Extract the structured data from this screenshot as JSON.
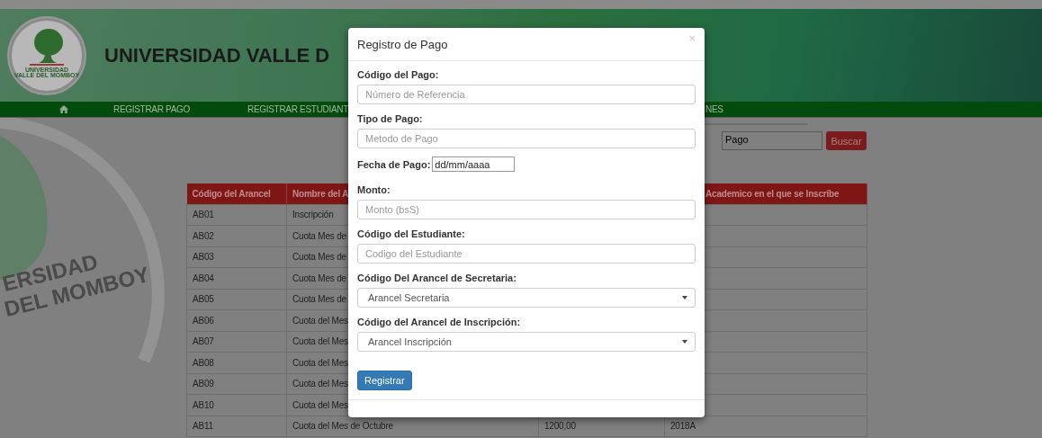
{
  "header": {
    "logo_lines": [
      "UNIVERSIDAD",
      "VALLE DEL MOMBOY"
    ],
    "title": "UNIVERSIDAD VALLE D"
  },
  "nav": [
    {
      "kind": "home"
    },
    {
      "kind": "link",
      "label": "REGISTRAR PAGO"
    },
    {
      "kind": "link",
      "label": "REGISTRAR ESTUDIANT"
    },
    {
      "kind": "link",
      "label": "NES"
    }
  ],
  "watermark": [
    "ERSIDAD",
    "DEL MOMBOY"
  ],
  "search": {
    "value": "Pago",
    "button": "Buscar"
  },
  "table": {
    "columns": {
      "code": "Código del Arancel",
      "name": "Nombre del A",
      "column_4": "Academico en el que se Inscribe"
    },
    "rows": [
      {
        "code": "AB01",
        "name": "Inscripción"
      },
      {
        "code": "AB02",
        "name": "Cuota Mes de"
      },
      {
        "code": "AB03",
        "name": "Cuota Mes de"
      },
      {
        "code": "AB04",
        "name": "Cuota Mes de"
      },
      {
        "code": "AB05",
        "name": "Cuota Mes de"
      },
      {
        "code": "AB06",
        "name": "Cuota del Mes"
      },
      {
        "code": "AB07",
        "name": "Cuota del Mes"
      },
      {
        "code": "AB08",
        "name": "Cuota del Mes"
      },
      {
        "code": "AB09",
        "name": "Cuota del Mes"
      },
      {
        "code": "AB10",
        "name": "Cuota del Mes"
      },
      {
        "code": "AB11",
        "name": "Cuota del Mes de Octubre",
        "column_3": "1200,00",
        "column_4": "2018A"
      }
    ]
  },
  "modal": {
    "title": "Registro de Pago",
    "close": "×",
    "fields": [
      {
        "kind": "text",
        "label": "Código del Pago:",
        "placeholder": "Número de Referencia"
      },
      {
        "kind": "text",
        "label": "Tipo de Pago:",
        "placeholder": "Metodo de Pago"
      },
      {
        "kind": "date",
        "label": "Fecha de Pago:",
        "value": "dd/mm/aaaa"
      },
      {
        "kind": "text",
        "label": "Monto:",
        "placeholder": "Monto (bsS)"
      },
      {
        "kind": "text",
        "label": "Código del Estudiante:",
        "placeholder": "Codigo del Estudiante"
      },
      {
        "kind": "select",
        "label": "Código Del Arancel de Secretaria:",
        "value": "Arancel Secretaria"
      },
      {
        "kind": "select",
        "label": "Código del Arancel de Inscripción:",
        "value": "Arancel Inscripción"
      }
    ],
    "submit": "Registrar"
  }
}
